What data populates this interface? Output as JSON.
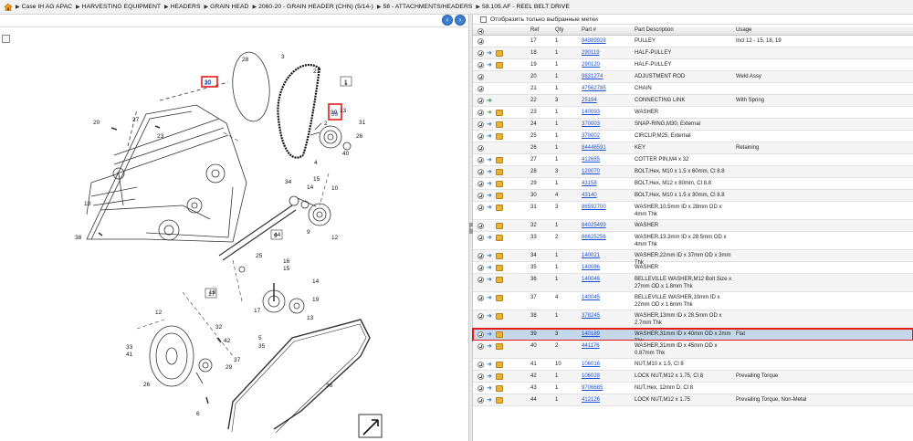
{
  "breadcrumb": [
    "Case IH AG APAC",
    "HARVESTING EQUIPMENT",
    "HEADERS",
    "GRAIN HEAD",
    "2060-20 - GRAIN HEADER (CHN) (5/14-)",
    "58 - ATTACHMENTS/HEADERS",
    "58.105.AF - REEL BELT DRIVE"
  ],
  "filter": {
    "label": "Отобразить только выбранные метки"
  },
  "columns": {
    "ref": "Ref",
    "qty": "Qty",
    "part": "Part #",
    "desc": "Part Description",
    "usage": "Usage"
  },
  "parts": [
    {
      "ref": "17",
      "qty": "1",
      "part": "84989928",
      "desc": "PULLEY",
      "usage": "Incl 12 - 15, 18, 19",
      "icons": [
        "plus"
      ]
    },
    {
      "ref": "18",
      "qty": "1",
      "part": "290119",
      "desc": "HALF-PULLEY",
      "usage": "",
      "icons": [
        "plus",
        "blue",
        "box"
      ]
    },
    {
      "ref": "19",
      "qty": "1",
      "part": "290120",
      "desc": "HALF-PULLEY",
      "usage": "",
      "icons": [
        "plus",
        "blue",
        "box"
      ]
    },
    {
      "ref": "20",
      "qty": "1",
      "part": "9831274",
      "desc": "ADJUSTMENT ROD",
      "usage": "Weld Assy",
      "icons": [
        "plus"
      ]
    },
    {
      "ref": "21",
      "qty": "1",
      "part": "47562785",
      "desc": "CHAIN",
      "usage": "",
      "icons": [
        "plus"
      ]
    },
    {
      "ref": "22",
      "qty": "3",
      "part": "25194",
      "desc": "CONNECTING LINK",
      "usage": "With Spring",
      "icons": [
        "plus",
        "blue",
        "green"
      ]
    },
    {
      "ref": "23",
      "qty": "1",
      "part": "140093",
      "desc": "WASHER",
      "usage": "",
      "icons": [
        "plus",
        "green",
        "box"
      ]
    },
    {
      "ref": "24",
      "qty": "1",
      "part": "370003",
      "desc": "SNAP-RING,M30, External",
      "usage": "",
      "icons": [
        "plus",
        "blue",
        "box"
      ]
    },
    {
      "ref": "25",
      "qty": "1",
      "part": "370002",
      "desc": "CIRCLIP,M25, External",
      "usage": "",
      "icons": [
        "plus",
        "blue",
        "box"
      ]
    },
    {
      "ref": "26",
      "qty": "1",
      "part": "84446591",
      "desc": "KEY",
      "usage": "Retaining",
      "icons": [
        "plus"
      ]
    },
    {
      "ref": "27",
      "qty": "1",
      "part": "412685",
      "desc": "COTTER PIN,M4 x 32",
      "usage": "",
      "icons": [
        "plus",
        "blue",
        "box"
      ]
    },
    {
      "ref": "28",
      "qty": "3",
      "part": "120070",
      "desc": "BOLT,Hex, M10 x 1.5 x 60mm, Cl 8.8",
      "usage": "",
      "icons": [
        "plus",
        "blue",
        "box"
      ]
    },
    {
      "ref": "29",
      "qty": "1",
      "part": "43158",
      "desc": "BOLT,Hex, M12 x 80mm, Cl 8.8",
      "usage": "",
      "icons": [
        "plus",
        "blue",
        "box"
      ]
    },
    {
      "ref": "30",
      "qty": "4",
      "part": "43140",
      "desc": "BOLT,Hex, M10 x 1.5 x 30mm, Cl 8.8",
      "usage": "",
      "icons": [
        "plus",
        "blue",
        "box"
      ]
    },
    {
      "ref": "31",
      "qty": "3",
      "part": "86592700",
      "desc": "WASHER,10.5mm ID x 28mm OD x 4mm Thk",
      "usage": "",
      "icons": [
        "plus",
        "blue",
        "box"
      ]
    },
    {
      "ref": "32",
      "qty": "1",
      "part": "84025499",
      "desc": "WASHER",
      "usage": "",
      "icons": [
        "plus",
        "box"
      ]
    },
    {
      "ref": "33",
      "qty": "2",
      "part": "86625256",
      "desc": "WASHER,13.3mm ID x 28.5mm OD x 4mm Thk",
      "usage": "",
      "icons": [
        "plus",
        "blue",
        "box"
      ]
    },
    {
      "ref": "34",
      "qty": "1",
      "part": "140021",
      "desc": "WASHER,22mm ID x 37mm OD x 3mm Thk",
      "usage": "",
      "icons": [
        "plus",
        "blue",
        "box"
      ]
    },
    {
      "ref": "35",
      "qty": "1",
      "part": "140086",
      "desc": "WASHER",
      "usage": "",
      "icons": [
        "plus",
        "blue",
        "box"
      ]
    },
    {
      "ref": "36",
      "qty": "1",
      "part": "140046",
      "desc": "BELLEVILLE WASHER,M12 Bolt Size x 27mm OD x 1.8mm Thk",
      "usage": "",
      "icons": [
        "plus",
        "blue",
        "box"
      ]
    },
    {
      "ref": "37",
      "qty": "4",
      "part": "140045",
      "desc": "BELLEVILLE WASHER,10mm ID x 22mm OD x 1.6mm Thk",
      "usage": "",
      "icons": [
        "plus",
        "blue",
        "box"
      ]
    },
    {
      "ref": "38",
      "qty": "1",
      "part": "378245",
      "desc": "WASHER,13mm ID x 28.5mm OD x 2.7mm Thk",
      "usage": "",
      "icons": [
        "plus",
        "blue",
        "box"
      ]
    },
    {
      "ref": "39",
      "qty": "3",
      "part": "140189",
      "desc": "WASHER,31mm ID x 40mm OD x 2mm Thk",
      "usage": "Flat",
      "icons": [
        "plus",
        "blue",
        "box"
      ],
      "highlight": true
    },
    {
      "ref": "40",
      "qty": "2",
      "part": "441176",
      "desc": "WASHER,31mm ID x 45mm OD x 0.87mm Thk",
      "usage": "",
      "icons": [
        "plus",
        "blue",
        "box"
      ]
    },
    {
      "ref": "41",
      "qty": "10",
      "part": "106016",
      "desc": "NUT,M10 x 1.5, Cl 8",
      "usage": "",
      "icons": [
        "plus",
        "blue",
        "box"
      ]
    },
    {
      "ref": "42",
      "qty": "1",
      "part": "106028",
      "desc": "LOCK NUT,M12 x 1.75, Cl 8",
      "usage": "Prevailing Torque",
      "icons": [
        "plus",
        "blue",
        "box"
      ]
    },
    {
      "ref": "43",
      "qty": "1",
      "part": "9706685",
      "desc": "NUT,Hex, 12mm D, Cl 8",
      "usage": "",
      "icons": [
        "plus",
        "blue",
        "box"
      ]
    },
    {
      "ref": "44",
      "qty": "1",
      "part": "412126",
      "desc": "LOCK NUT,M12 x 1.75",
      "usage": "Prevailing Torque, Non-Metal",
      "icons": [
        "plus",
        "blue",
        "box"
      ]
    }
  ],
  "diagram": {
    "callouts": [
      "28",
      "3",
      "21",
      "1",
      "30",
      "39",
      "31",
      "27",
      "20",
      "23",
      "2",
      "4",
      "40",
      "26",
      "34",
      "15",
      "14",
      "10",
      "13",
      "38",
      "44",
      "9",
      "12",
      "25",
      "16",
      "15",
      "14",
      "18",
      "17",
      "19",
      "13",
      "12",
      "32",
      "42",
      "33",
      "41",
      "37",
      "26",
      "5",
      "35",
      "36",
      "6",
      "29",
      "13",
      "22",
      "39"
    ],
    "boxed_callouts": [
      "1",
      "9",
      "17",
      "30",
      "39"
    ]
  },
  "colors": {
    "link": "#1a4fd6",
    "highlight": "#e21c1c",
    "nav": "#3b7fd0"
  }
}
